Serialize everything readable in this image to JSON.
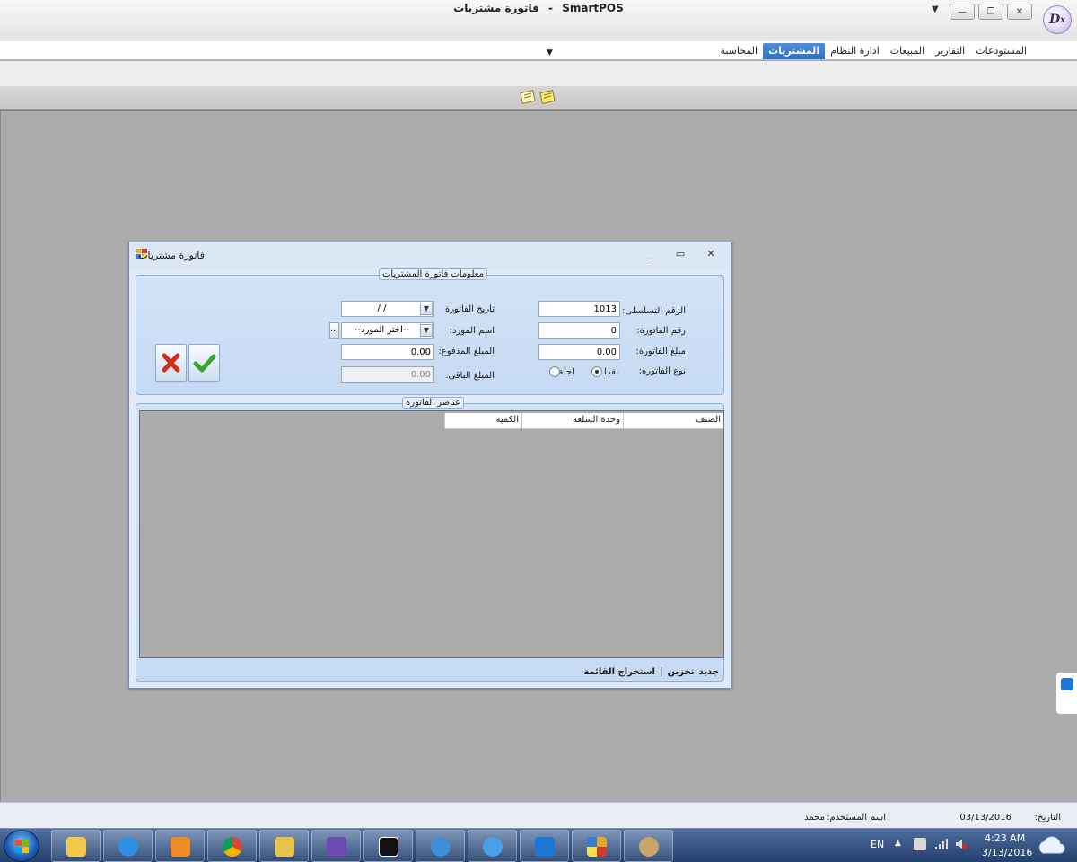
{
  "window": {
    "title_app": "SmartPOS",
    "title_sep": "-",
    "title_doc": "فاتورة مشتريات"
  },
  "ribbon": {
    "tabs": [
      "المستودعات",
      "التقارير",
      "المبيعات",
      "ادارة النظام",
      "المشتريات",
      "المحاسبة"
    ],
    "active_index": 4
  },
  "child": {
    "title": "فاتورة مشتريات",
    "info_group": "معلومات فاتورة المشتريات",
    "fields": {
      "serial_label": "الرقم التسلسلى:",
      "serial_value": "1013",
      "invoice_no_label": "رقم الفاتورة:",
      "invoice_no_value": "0",
      "amount_label": "مبلغ الفاتورة:",
      "amount_value": "0.00",
      "type_label": "نوع الفاتورة:",
      "type_cash": "نقدا",
      "type_credit": "اجلة",
      "type_selected": "نقدا",
      "date_label": "تاريخ الفاتورة",
      "date_value": "/   /",
      "supplier_label": "اسم المورد:",
      "supplier_value": "--اختر المورد--",
      "paid_label": "المبلغ المدفوع:",
      "paid_value": "0.00",
      "remaining_label": "المبلغ الباقى:",
      "remaining_value": "0.00"
    },
    "items_group": "عناصر الفاتورة",
    "grid_columns": [
      "الصنف",
      "وحدة السلعة",
      "الكمية"
    ],
    "footer_links": [
      "جديد",
      "تخزين",
      "|",
      "استخراج القائمة"
    ]
  },
  "statusbar": {
    "date_label": "التاريخ:",
    "date_value": "03/13/2016",
    "user_label": "اسم المستخدم:",
    "user_value": "محمد"
  },
  "taskbar": {
    "lang": "EN",
    "time": "4:23 AM",
    "date": "3/13/2016"
  },
  "colors": {
    "accent": "#2f6fc2",
    "mdi_bg": "#ababab",
    "form_bg": "#d3e3f7",
    "ok_green": "#3aa628",
    "cancel_red": "#d12b1a"
  }
}
